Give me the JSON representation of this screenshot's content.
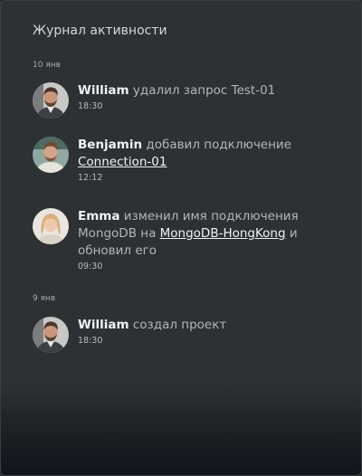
{
  "panel": {
    "title": "Журнал активности"
  },
  "groups": [
    {
      "date": "10 янв",
      "entries": [
        {
          "user": "William",
          "action": "удалил запрос Test-01",
          "time": "18:30"
        },
        {
          "user": "Benjamin",
          "action": "добавил подключение",
          "link": "Connection-01",
          "time": "12:12"
        },
        {
          "user": "Emma",
          "action": "изменил имя подключения MongoDB на",
          "link": "MongoDB-HongKong",
          "suffix": "и обновил его",
          "time": "09:30"
        }
      ]
    },
    {
      "date": "9 янв",
      "entries": [
        {
          "user": "William",
          "action": "создал проект",
          "time": "18:30"
        }
      ]
    }
  ]
}
